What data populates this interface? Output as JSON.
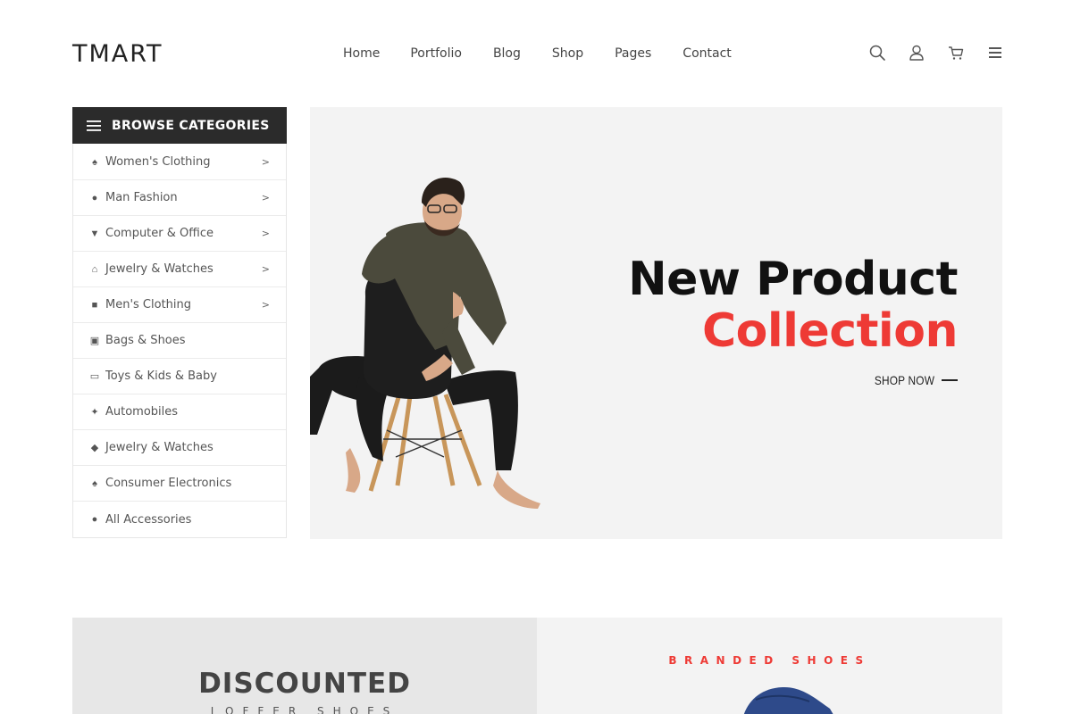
{
  "header": {
    "logo": "TMART",
    "nav": [
      "Home",
      "Portfolio",
      "Blog",
      "Shop",
      "Pages",
      "Contact"
    ],
    "icons": [
      "search-icon",
      "user-icon",
      "cart-icon",
      "menu-icon"
    ]
  },
  "sidebar": {
    "heading": "BROWSE CATEGORIES",
    "items": [
      {
        "label": "Women's Clothing",
        "icon": "female-icon",
        "has_submenu": true
      },
      {
        "label": "Man Fashion",
        "icon": "user-icon",
        "has_submenu": true
      },
      {
        "label": "Computer & Office",
        "icon": "trophy-icon",
        "has_submenu": true
      },
      {
        "label": "Jewelry & Watches",
        "icon": "home-icon",
        "has_submenu": true
      },
      {
        "label": "Men's Clothing",
        "icon": "coffee-icon",
        "has_submenu": true
      },
      {
        "label": "Bags & Shoes",
        "icon": "building-icon",
        "has_submenu": false
      },
      {
        "label": "Toys & Kids & Baby",
        "icon": "laptop-icon",
        "has_submenu": false
      },
      {
        "label": "Automobiles",
        "icon": "plug-icon",
        "has_submenu": false
      },
      {
        "label": "Jewelry & Watches",
        "icon": "tags-icon",
        "has_submenu": false
      },
      {
        "label": "Consumer Electronics",
        "icon": "female-icon",
        "has_submenu": false
      },
      {
        "label": "All Accessories",
        "icon": "user-icon",
        "has_submenu": false
      }
    ],
    "arrow": ">"
  },
  "hero": {
    "title_line1": "New Product",
    "title_line2": "Collection",
    "cta": "SHOP NOW",
    "accent_color": "#ee3a35"
  },
  "banners": {
    "left_title": "DISCOUNTED",
    "left_subtitle": "LOFFER SHOES",
    "right_title": "BRANDED SHOES"
  }
}
